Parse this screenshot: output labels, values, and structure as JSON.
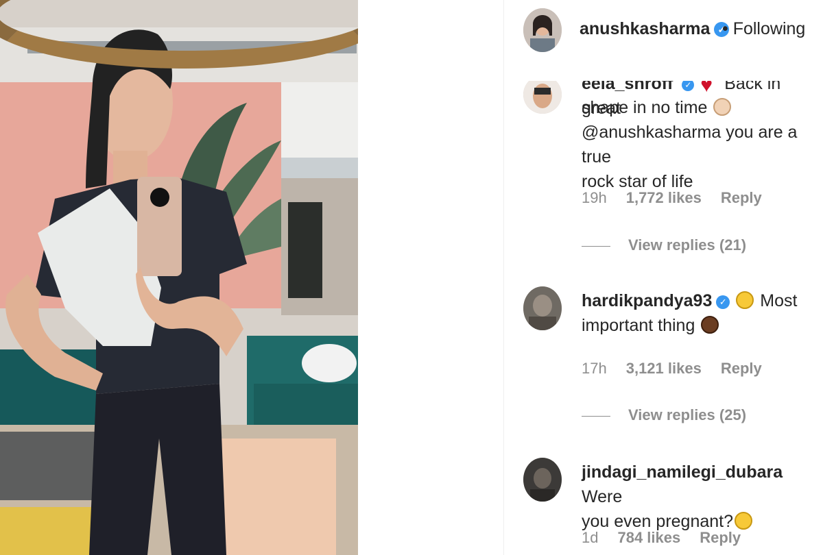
{
  "header": {
    "username": "anushkasharma",
    "verified_mark": "✓",
    "follow_status": "• Following"
  },
  "comments": [
    {
      "username": "eela_shroff",
      "text_lines": [
        "shape in no time",
        "@anushkasharma you are a true",
        "rock star of life"
      ],
      "partial_top": "Back in great",
      "time": "19h",
      "likes": "1,772 likes",
      "reply": "Reply",
      "view_replies": "View replies (21)"
    },
    {
      "username": "hardikpandya93",
      "text": "Most important thing",
      "text_a": "Most",
      "text_b": "important thing",
      "time": "17h",
      "likes": "3,121 likes",
      "reply": "Reply",
      "view_replies": "View replies (25)"
    },
    {
      "username": "jindagi_namilegi_dubara",
      "text_a": "Were",
      "text_b": "you even pregnant?",
      "time": "1d",
      "likes": "784 likes",
      "reply": "Reply"
    }
  ],
  "icons": {
    "verified": "verified-badge-icon",
    "heart": "red-heart-emoji",
    "clap": "clap-emoji",
    "laugh": "laughing-emoji",
    "hand": "hand-emoji",
    "shock": "shocked-emoji"
  },
  "colors": {
    "verified_blue": "#3897f0",
    "meta_gray": "#8e8e8e",
    "text": "#262626"
  }
}
